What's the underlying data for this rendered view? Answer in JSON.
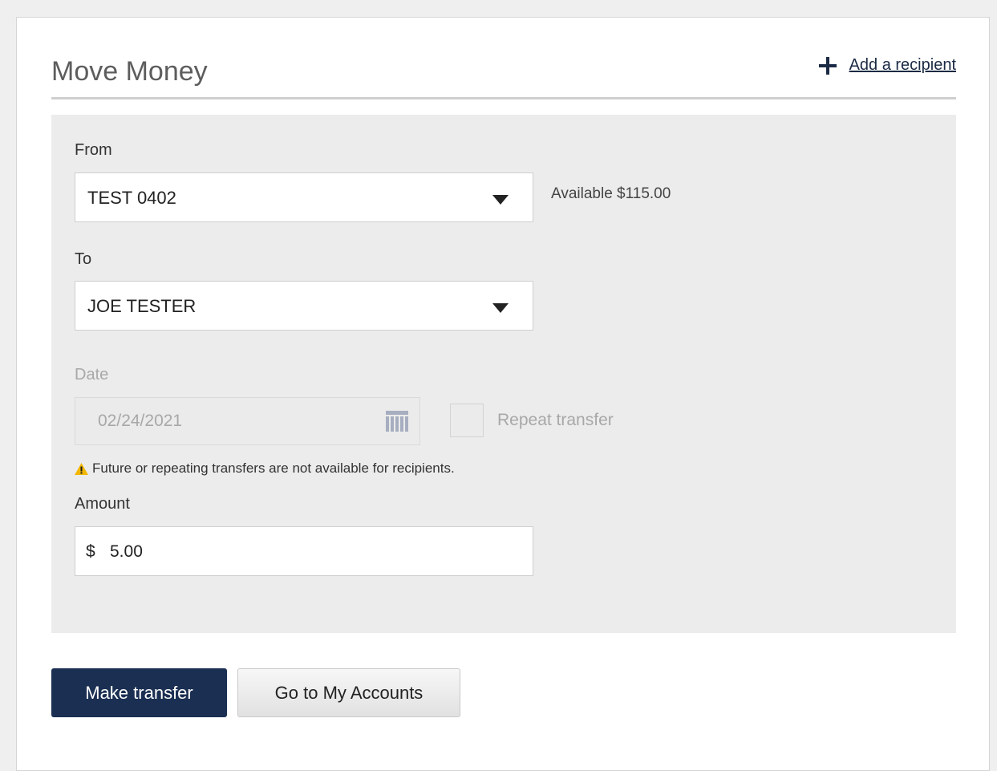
{
  "header": {
    "title": "Move Money",
    "add_recipient_label": "Add a recipient"
  },
  "form": {
    "from": {
      "label": "From",
      "selected": "TEST 0402",
      "available_text": "Available $115.00"
    },
    "to": {
      "label": "To",
      "selected": "JOE TESTER"
    },
    "date": {
      "label": "Date",
      "value": "02/24/2021",
      "disabled": true
    },
    "repeat": {
      "label": "Repeat transfer",
      "checked": false,
      "disabled": true
    },
    "warning_text": "Future or repeating transfers are not available for recipients.",
    "amount": {
      "label": "Amount",
      "currency_symbol": "$",
      "value": "5.00"
    }
  },
  "actions": {
    "make_transfer_label": "Make transfer",
    "go_to_accounts_label": "Go to My Accounts"
  },
  "icons": {
    "add": "plus-icon",
    "dropdown": "caret-down-icon",
    "calendar": "calendar-icon",
    "warning": "warning-icon"
  },
  "colors": {
    "primary": "#1b2f52",
    "panel_background": "#ececec",
    "warning": "#f2b705"
  }
}
